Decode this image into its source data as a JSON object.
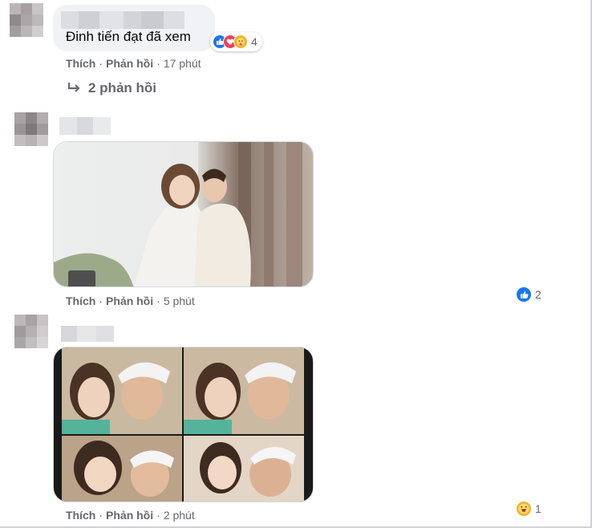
{
  "comments": [
    {
      "text": "Đinh tiến đạt đã xem",
      "reactions": {
        "icons": [
          "like-icon",
          "love-icon",
          "care-icon"
        ],
        "count": "4"
      },
      "actions": {
        "like": "Thích",
        "reply": "Phản hồi",
        "time": "17 phút"
      },
      "replies_link": "2 phản hồi"
    },
    {
      "reactions": {
        "icons": [
          "like-icon"
        ],
        "count": "2"
      },
      "actions": {
        "like": "Thích",
        "reply": "Phản hồi",
        "time": "5 phút"
      }
    },
    {
      "reactions": {
        "icons": [
          "haha-icon"
        ],
        "count": "1"
      },
      "actions": {
        "like": "Thích",
        "reply": "Phản hồi",
        "time": "2 phút"
      }
    }
  ],
  "colors": {
    "like": "#1877f2",
    "love": "#f33e58",
    "care": "#f7b125",
    "haha": "#f7b125",
    "secondary_text": "#65676b",
    "bubble": "#f0f2f5"
  }
}
